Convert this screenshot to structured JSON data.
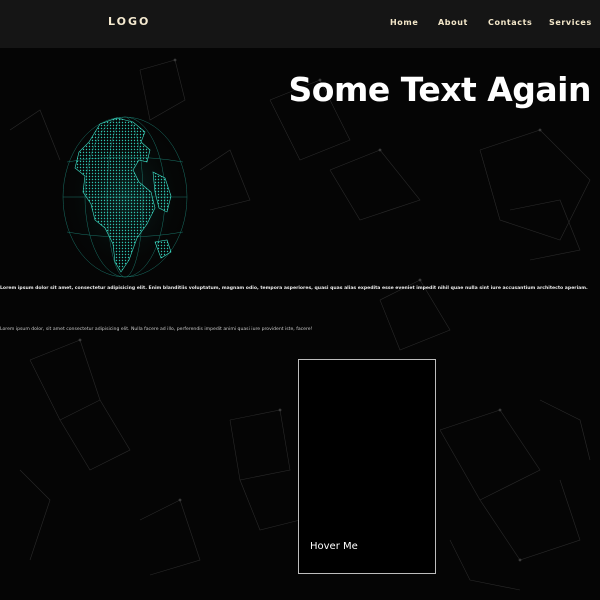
{
  "navbar": {
    "logo": "LOGO",
    "links": [
      {
        "label": "Home"
      },
      {
        "label": "About"
      },
      {
        "label": "Contacts"
      },
      {
        "label": "Services"
      }
    ]
  },
  "hero": {
    "title": "Some Text Again",
    "paragraph1": "Lorem ipsum dolor sit amet, consectetur adipisicing elit. Enim blanditiis voluptatum, magnam odio, tempora asperiores, quasi quas alias expedita esse eveniet impedit nihil quae nulla sint iure accusantium architecto aperiam.",
    "paragraph2": "Lorem ipsum dolor, sit amet consectetur adipisicing elit. Nulla facere ad illo, perferendis impedit animi quasi iure provident iste, facere!"
  },
  "card": {
    "label": "Hover Me"
  },
  "colors": {
    "background": "#050505",
    "navbar": "#151515",
    "nav_text": "#f3e7c9",
    "globe": "#2ec4b0"
  },
  "icons": {
    "globe": "globe-icon"
  }
}
